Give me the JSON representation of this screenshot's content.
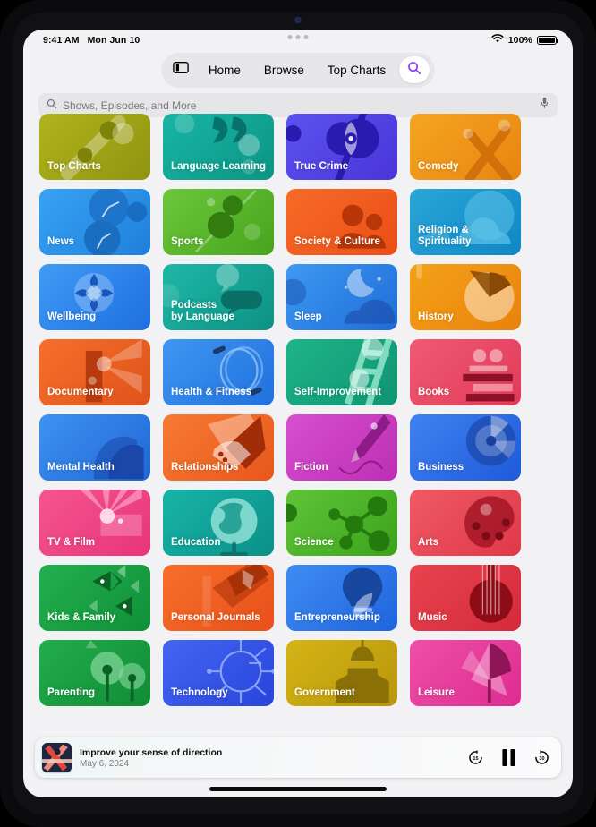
{
  "statusbar": {
    "time": "9:41 AM",
    "date": "Mon Jun 10",
    "wifi_icon": "wifi-icon",
    "battery_percent": "100%",
    "battery_icon": "battery-icon"
  },
  "navbar": {
    "sidebar_icon": "sidebar-toggle-icon",
    "tabs": [
      {
        "label": "Home"
      },
      {
        "label": "Browse"
      },
      {
        "label": "Top Charts"
      }
    ],
    "search_icon": "search-icon",
    "search_active_color": "#8a3ffc"
  },
  "search": {
    "placeholder": "Shows, Episodes, and More",
    "value": "",
    "leading_icon": "search-icon",
    "trailing_icon": "microphone-icon"
  },
  "categories": [
    {
      "label": "Top Charts",
      "c1": "#b0b41c",
      "c2": "#8f9410",
      "accent": "#7d8308",
      "motif": "charts"
    },
    {
      "label": "Language Learning",
      "c1": "#18b5a4",
      "c2": "#0c9585",
      "accent": "#06736a",
      "motif": "quotes"
    },
    {
      "label": "True Crime",
      "c1": "#5b52f0",
      "c2": "#4a35d8",
      "accent": "#2a1bb0",
      "motif": "eye"
    },
    {
      "label": "Comedy",
      "c1": "#f5a623",
      "c2": "#e8840f",
      "accent": "#d2700a",
      "motif": "rays"
    },
    {
      "label": "News",
      "c1": "#37a3f5",
      "c2": "#1f7fdb",
      "accent": "#1a6ec2",
      "motif": "clock"
    },
    {
      "label": "Sports",
      "c1": "#6dc73c",
      "c2": "#46a41c",
      "accent": "#327c10",
      "motif": "nodes"
    },
    {
      "label": "Society & Culture",
      "c1": "#f76b28",
      "c2": "#ea4e16",
      "accent": "#b93608",
      "motif": "people"
    },
    {
      "label": "Religion &\nSpirituality",
      "c1": "#2aa6d8",
      "c2": "#0e87c4",
      "accent": "#5fc3e8",
      "motif": "clouds"
    },
    {
      "label": "Wellbeing",
      "c1": "#3f9bf5",
      "c2": "#1f6fe0",
      "accent": "#1a55c0",
      "motif": "flower"
    },
    {
      "label": "Podcasts\nby Language",
      "c1": "#1eb8a6",
      "c2": "#0d9285",
      "accent": "#0a6f66",
      "motif": "bubbles"
    },
    {
      "label": "Sleep",
      "c1": "#3e9af2",
      "c2": "#1f6cd8",
      "accent": "#1c4fae",
      "motif": "moon"
    },
    {
      "label": "History",
      "c1": "#f5a218",
      "c2": "#e8820c",
      "accent": "#8a4a06",
      "motif": "pie"
    },
    {
      "label": "Documentary",
      "c1": "#f5702b",
      "c2": "#e0521a",
      "accent": "#b63a0c",
      "motif": "projector"
    },
    {
      "label": "Health & Fitness",
      "c1": "#3f97f2",
      "c2": "#2070dd",
      "accent": "#93c4f7",
      "motif": "rope"
    },
    {
      "label": "Self-Improvement",
      "c1": "#1eb489",
      "c2": "#0e9472",
      "accent": "#7fdcbe",
      "motif": "ladder"
    },
    {
      "label": "Books",
      "c1": "#ef5a72",
      "c2": "#e23a58",
      "accent": "#8e1027",
      "motif": "books"
    },
    {
      "label": "Mental Health",
      "c1": "#3f93f2",
      "c2": "#2066d6",
      "accent": "#1a47a8",
      "motif": "heads"
    },
    {
      "label": "Relationships",
      "c1": "#f77b33",
      "c2": "#e8571c",
      "accent": "#a02c08",
      "motif": "hands"
    },
    {
      "label": "Fiction",
      "c1": "#d84fd0",
      "c2": "#bc2fb4",
      "accent": "#8d1c88",
      "motif": "pen"
    },
    {
      "label": "Business",
      "c1": "#3f82f2",
      "c2": "#1f5ad8",
      "accent": "#173f9e",
      "motif": "radar"
    },
    {
      "label": "TV & Film",
      "c1": "#f4558e",
      "c2": "#e8357a",
      "accent": "#fa9bc0",
      "motif": "spotlight"
    },
    {
      "label": "Education",
      "c1": "#17b4a8",
      "c2": "#0b9088",
      "accent": "#8fe0d6",
      "motif": "globe"
    },
    {
      "label": "Science",
      "c1": "#5fc43a",
      "c2": "#3ba31a",
      "accent": "#247a0c",
      "motif": "molecule"
    },
    {
      "label": "Arts",
      "c1": "#ef5a65",
      "c2": "#e03848",
      "accent": "#9c1020",
      "motif": "palette"
    },
    {
      "label": "Kids & Family",
      "c1": "#23b04f",
      "c2": "#109038",
      "accent": "#0a6325",
      "motif": "fish"
    },
    {
      "label": "Personal Journals",
      "c1": "#f76f2a",
      "c2": "#e8501a",
      "accent": "#a83208",
      "motif": "journal"
    },
    {
      "label": "Entrepreneurship",
      "c1": "#3f8cf2",
      "c2": "#1f64de",
      "accent": "#17479e",
      "motif": "bulb"
    },
    {
      "label": "Music",
      "c1": "#e8434f",
      "c2": "#d42a3a",
      "accent": "#8e0c18",
      "motif": "guitar"
    },
    {
      "label": "Parenting",
      "c1": "#23ad4c",
      "c2": "#108c36",
      "accent": "#7fd498",
      "motif": "trees"
    },
    {
      "label": "Technology",
      "c1": "#4466f2",
      "c2": "#2744dc",
      "accent": "#8aa3f8",
      "motif": "circuit"
    },
    {
      "label": "Government",
      "c1": "#d4b415",
      "c2": "#b8960a",
      "accent": "#8a7006",
      "motif": "capitol"
    },
    {
      "label": "Leisure",
      "c1": "#ef4fa8",
      "c2": "#dd2c90",
      "accent": "#8e1558",
      "motif": "umbrella"
    }
  ],
  "now_playing": {
    "title": "Improve your sense of direction",
    "date": "May 6, 2024",
    "artwork_name": "episode-artwork",
    "skip_back_label": "15",
    "skip_forward_label": "30",
    "play_state": "playing"
  }
}
